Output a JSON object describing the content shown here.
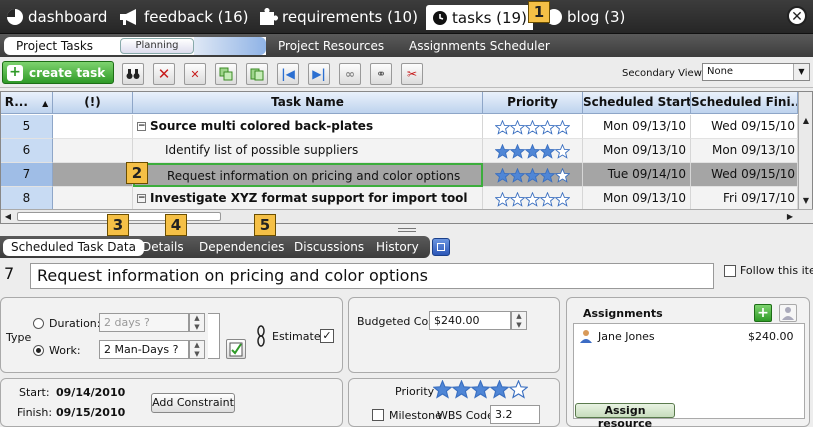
{
  "nav": {
    "items": [
      {
        "label": "dashboard",
        "icon": "pie-chart-icon"
      },
      {
        "label": "feedback (16)",
        "icon": "megaphone-icon"
      },
      {
        "label": "requirements (10)",
        "icon": "puzzle-icon"
      },
      {
        "label": "tasks (19)",
        "icon": "clock-icon",
        "active": true
      },
      {
        "label": "blog (3)",
        "icon": "blog-icon"
      }
    ],
    "close_label": "✕"
  },
  "subnav": {
    "items": [
      "Project Tasks",
      "Planning",
      "Project Resources",
      "Assignments Scheduler"
    ]
  },
  "toolbar": {
    "create_label": "create task",
    "secondary_view_label": "Secondary View:",
    "secondary_view_value": "None"
  },
  "grid": {
    "headers": [
      "R...",
      "(!)",
      "Task Name",
      "Priority",
      "Scheduled Start",
      "Scheduled Fini..."
    ],
    "rows": [
      {
        "num": "5",
        "name": "Source multi colored back-plates",
        "summary": true,
        "stars": 0,
        "start": "Mon 09/13/10",
        "finish": "Wed 09/15/10"
      },
      {
        "num": "6",
        "name": "Identify list of possible suppliers",
        "summary": false,
        "stars": 4,
        "start": "Mon 09/13/10",
        "finish": "Mon 09/13/10"
      },
      {
        "num": "7",
        "name": "Request information on pricing and color options",
        "summary": false,
        "stars": 4,
        "start": "Tue 09/14/10",
        "finish": "Wed 09/15/10",
        "selected": true
      },
      {
        "num": "8",
        "name": "Investigate XYZ format support for import tool",
        "summary": true,
        "stars": 0,
        "start": "Mon 09/13/10",
        "finish": "Fri 09/17/10"
      }
    ]
  },
  "detail_tabs": [
    "Scheduled Task Data",
    "Details",
    "Dependencies",
    "Discussions",
    "History"
  ],
  "task": {
    "number": "7",
    "title": "Request information on pricing and color options",
    "follow_label": "Follow this item"
  },
  "type_panel": {
    "type_label": "Type",
    "duration_label": "Duration:",
    "duration_value": "2 days ?",
    "work_label": "Work:",
    "work_value": "2 Man-Days ?",
    "estimated_label": "Estimated"
  },
  "cost_panel": {
    "label": "Budgeted Cost:",
    "value": "$240.00"
  },
  "assignments": {
    "title": "Assignments",
    "items": [
      {
        "name": "Jane Jones",
        "amount": "$240.00"
      }
    ],
    "assign_label": "Assign resource"
  },
  "dates_panel": {
    "start_label": "Start:",
    "start_value": "09/14/2010",
    "finish_label": "Finish:",
    "finish_value": "09/15/2010",
    "constraint_label": "Add Constraint"
  },
  "priority_panel": {
    "priority_label": "Priority",
    "priority_stars": 4,
    "milestone_label": "Milestone",
    "wbs_label": "WBS Code",
    "wbs_value": "3.2"
  },
  "callouts": [
    "1",
    "2",
    "3",
    "4",
    "5"
  ]
}
